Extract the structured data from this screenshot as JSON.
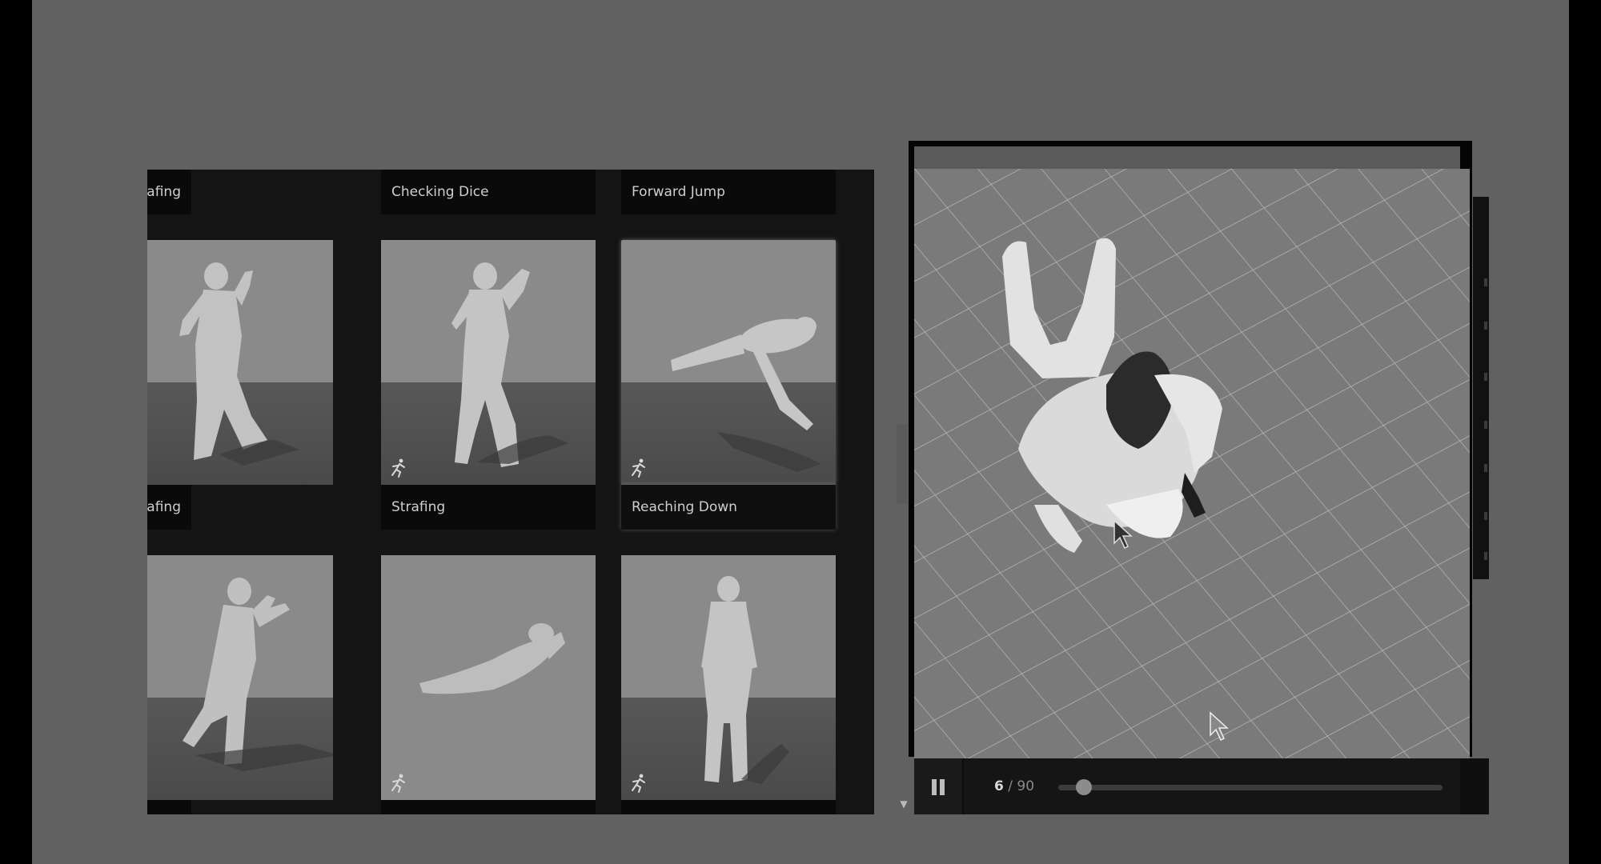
{
  "grid": {
    "rows": [
      {
        "labels": [
          "Strafing",
          "Checking Dice",
          "Forward Jump"
        ]
      },
      {
        "labels": [
          "Strafing",
          "Strafing",
          "Reaching Down"
        ],
        "highlight_col": 2
      }
    ]
  },
  "icons": {
    "card_badge": "running-person-icon",
    "pause": "pause-icon",
    "scroll_down": "chevron-down-icon",
    "cursor": "mouse-pointer-icon"
  },
  "player": {
    "current_frame": "6",
    "separator": "/",
    "total_frames": "90",
    "progress": 0.0667
  },
  "colors": {
    "background": "#616161",
    "panel": "#141414",
    "card": "#8a8a8a",
    "viewer": "#737373"
  }
}
